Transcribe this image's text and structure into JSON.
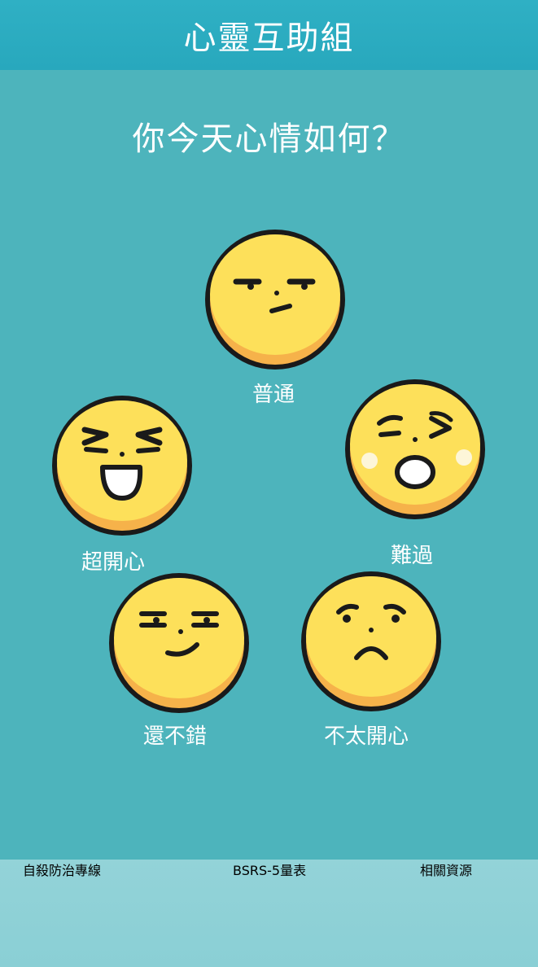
{
  "header": {
    "title": "心靈互助組"
  },
  "question": "你今天心情如何？",
  "moods": {
    "neutral": {
      "label": "普通"
    },
    "sad": {
      "label": "難過"
    },
    "very_happy": {
      "label": "超開心"
    },
    "okay": {
      "label": "還不錯"
    },
    "unhappy": {
      "label": "不太開心"
    }
  },
  "footer": {
    "items": [
      {
        "label": "自殺防治專線"
      },
      {
        "label": "BSRS-5量表"
      },
      {
        "label": "相關資源"
      }
    ]
  },
  "colors": {
    "background": "#4db4bc",
    "header": "#2aabbf",
    "footer": "#8fd1d6",
    "face": "#fde05a",
    "face_shadow": "#f6b24a",
    "tear": "#fdf6d8"
  }
}
